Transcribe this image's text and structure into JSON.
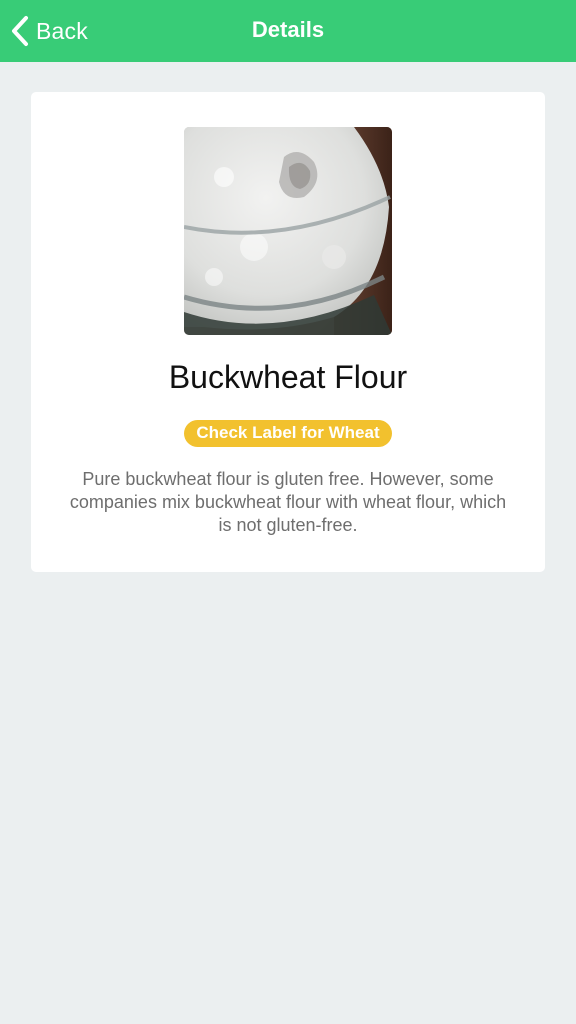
{
  "navbar": {
    "back_label": "Back",
    "title": "Details",
    "background_color": "#38cc77",
    "back_icon": "chevron-left-icon"
  },
  "product": {
    "name": "Buckwheat Flour",
    "status_label": "Check Label for Wheat",
    "status_color": "#f2c12e",
    "description": "Pure buckwheat flour is gluten free. However, some companies mix buckwheat flour with wheat flour, which is not gluten-free."
  }
}
